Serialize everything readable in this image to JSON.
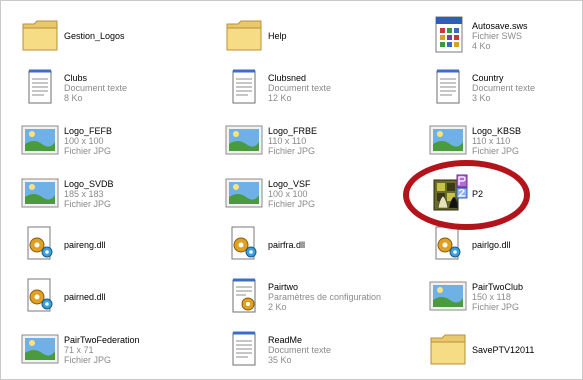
{
  "files": [
    {
      "name": "Gestion_Logos",
      "icon": "folder-icon",
      "details": []
    },
    {
      "name": "Help",
      "icon": "folder-icon",
      "details": []
    },
    {
      "name": "Autosave.sws",
      "icon": "sws-file-icon",
      "details": [
        "Fichier SWS",
        "4 Ko"
      ]
    },
    {
      "name": "Clubs",
      "icon": "text-document-icon",
      "details": [
        "Document texte",
        "8 Ko"
      ]
    },
    {
      "name": "Clubsned",
      "icon": "text-document-icon",
      "details": [
        "Document texte",
        "12 Ko"
      ]
    },
    {
      "name": "Country",
      "icon": "text-document-icon",
      "details": [
        "Document texte",
        "3 Ko"
      ]
    },
    {
      "name": "Logo_FEFB",
      "icon": "jpg-image-icon",
      "details": [
        "100 x 100",
        "Fichier JPG"
      ]
    },
    {
      "name": "Logo_FRBE",
      "icon": "jpg-image-icon",
      "details": [
        "110 x 110",
        "Fichier JPG"
      ]
    },
    {
      "name": "Logo_KBSB",
      "icon": "jpg-image-icon",
      "details": [
        "110 x 110",
        "Fichier JPG"
      ]
    },
    {
      "name": "Logo_SVDB",
      "icon": "jpg-image-icon",
      "details": [
        "185 x 183",
        "Fichier JPG"
      ]
    },
    {
      "name": "Logo_VSF",
      "icon": "jpg-image-icon",
      "details": [
        "100 x 100",
        "Fichier JPG"
      ]
    },
    {
      "name": "P2",
      "icon": "p2-application-icon",
      "details": []
    },
    {
      "name": "paireng.dll",
      "icon": "dll-file-icon",
      "details": []
    },
    {
      "name": "pairfra.dll",
      "icon": "dll-file-icon",
      "details": []
    },
    {
      "name": "pairlgo.dll",
      "icon": "dll-file-icon",
      "details": []
    },
    {
      "name": "pairned.dll",
      "icon": "dll-file-icon",
      "details": []
    },
    {
      "name": "Pairtwo",
      "icon": "config-file-icon",
      "details": [
        "Paramètres de configuration",
        "2 Ko"
      ]
    },
    {
      "name": "PairTwoClub",
      "icon": "jpg-image-icon",
      "details": [
        "150 x 118",
        "Fichier JPG"
      ]
    },
    {
      "name": "PairTwoFederation",
      "icon": "jpg-image-icon",
      "details": [
        "71 x 71",
        "Fichier JPG"
      ]
    },
    {
      "name": "ReadMe",
      "icon": "text-document-icon",
      "details": [
        "Document texte",
        "35 Ko"
      ]
    },
    {
      "name": "SavePTV12011",
      "icon": "folder-icon",
      "details": []
    }
  ],
  "colors": {
    "highlight_ring": "#b3141b",
    "subtext": "#8a8a8a"
  }
}
